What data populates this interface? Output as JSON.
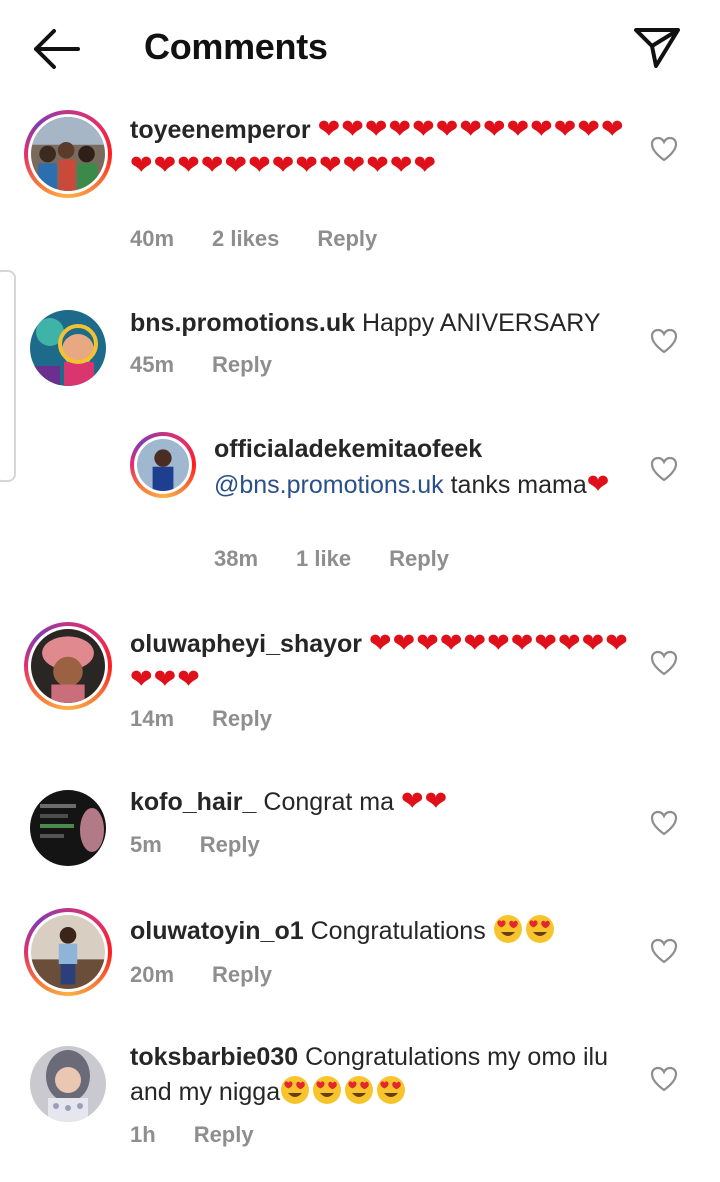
{
  "header": {
    "title": "Comments",
    "back_icon": "arrow-left-icon",
    "share_icon": "paper-plane-icon"
  },
  "colors": {
    "heart": "#e0101a",
    "meta_text": "#8e8e8e",
    "mention": "#2a4f8a"
  },
  "comments": [
    {
      "username": "toyeenemperor",
      "text": "",
      "heart_count": 26,
      "time": "40m",
      "likes": "2 likes",
      "reply": "Reply"
    },
    {
      "username": "bns.promotions.uk",
      "text": "Happy ANIVERSARY",
      "time": "45m",
      "reply": "Reply"
    },
    {
      "username": "officialadekemitaofeek",
      "mention": "@bns.promotions.uk",
      "text": "tanks mama",
      "heart_count": 1,
      "time": "38m",
      "likes": "1 like",
      "reply": "Reply",
      "is_reply": true
    },
    {
      "username": "oluwapheyi_shayor",
      "text": "",
      "heart_count": 14,
      "time": "14m",
      "reply": "Reply"
    },
    {
      "username": "kofo_hair_",
      "text": "Congrat ma",
      "heart_count": 2,
      "time": "5m",
      "reply": "Reply"
    },
    {
      "username": "oluwatoyin_o1",
      "text": "Congratulations",
      "emoji_count": 2,
      "emoji": "heart-eyes-emoji",
      "time": "20m",
      "reply": "Reply"
    },
    {
      "username": "toksbarbie030",
      "text": "Congratulations my omo ilu and my nigga",
      "emoji_count": 4,
      "emoji": "heart-eyes-emoji",
      "time": "1h",
      "reply": "Reply"
    }
  ]
}
